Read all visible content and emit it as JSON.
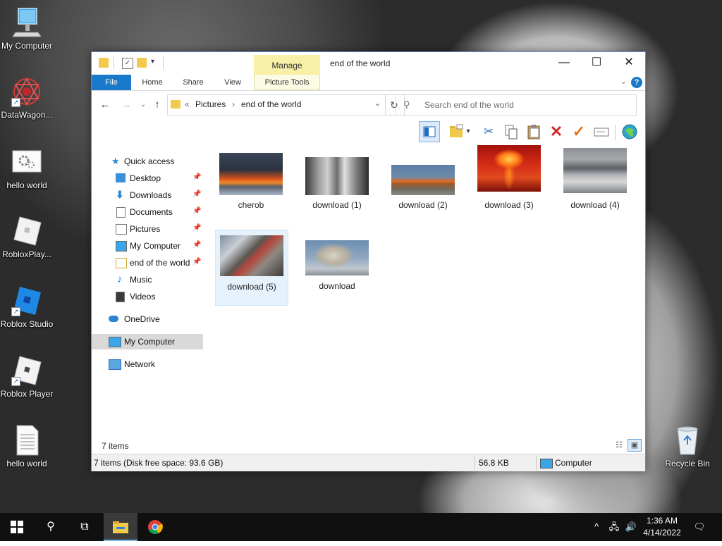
{
  "desktop": {
    "icons": [
      {
        "label": "My Computer"
      },
      {
        "label": "DataWagon..."
      },
      {
        "label": "hello world"
      },
      {
        "label": "RobloxPlay..."
      },
      {
        "label": "Roblox Studio"
      },
      {
        "label": "Roblox Player"
      },
      {
        "label": "hello world"
      },
      {
        "label": "Recycle Bin"
      }
    ]
  },
  "window": {
    "title": "end of the world",
    "context_tab": "Manage",
    "controls": {
      "minimize": "—",
      "maximize": "☐",
      "close": "✕"
    },
    "ribbon_tabs": [
      "File",
      "Home",
      "Share",
      "View",
      "Picture Tools"
    ],
    "help_label": "?",
    "address": {
      "overflow": "«",
      "crumbs": [
        "Pictures",
        "end of the world"
      ],
      "separator": "›"
    },
    "search": {
      "placeholder": "Search end of the world"
    },
    "toolbar_icons": [
      "preview-pane-icon",
      "new-folder-icon",
      "cut-icon",
      "copy-icon",
      "paste-icon",
      "delete-icon",
      "checkmark-icon",
      "rename-icon",
      "globe-icon"
    ],
    "sidebar": {
      "quick_access": "Quick access",
      "pinned": [
        {
          "label": "Desktop"
        },
        {
          "label": "Downloads"
        },
        {
          "label": "Documents"
        },
        {
          "label": "Pictures"
        },
        {
          "label": "My Computer"
        },
        {
          "label": "end of the world"
        }
      ],
      "unpinned": [
        {
          "label": "Music"
        },
        {
          "label": "Videos"
        }
      ],
      "onedrive": "OneDrive",
      "my_computer": "My Computer",
      "network": "Network"
    },
    "files": [
      {
        "name": "cherob"
      },
      {
        "name": "download (1)"
      },
      {
        "name": "download (2)"
      },
      {
        "name": "download (3)"
      },
      {
        "name": "download (4)"
      },
      {
        "name": "download (5)"
      },
      {
        "name": "download"
      }
    ],
    "item_count": "7 items",
    "status": {
      "summary": "7 items (Disk free space: 93.6 GB)",
      "size": "56.8 KB",
      "location": "Computer"
    }
  },
  "taskbar": {
    "time": "1:36 AM",
    "date": "4/14/2022"
  }
}
